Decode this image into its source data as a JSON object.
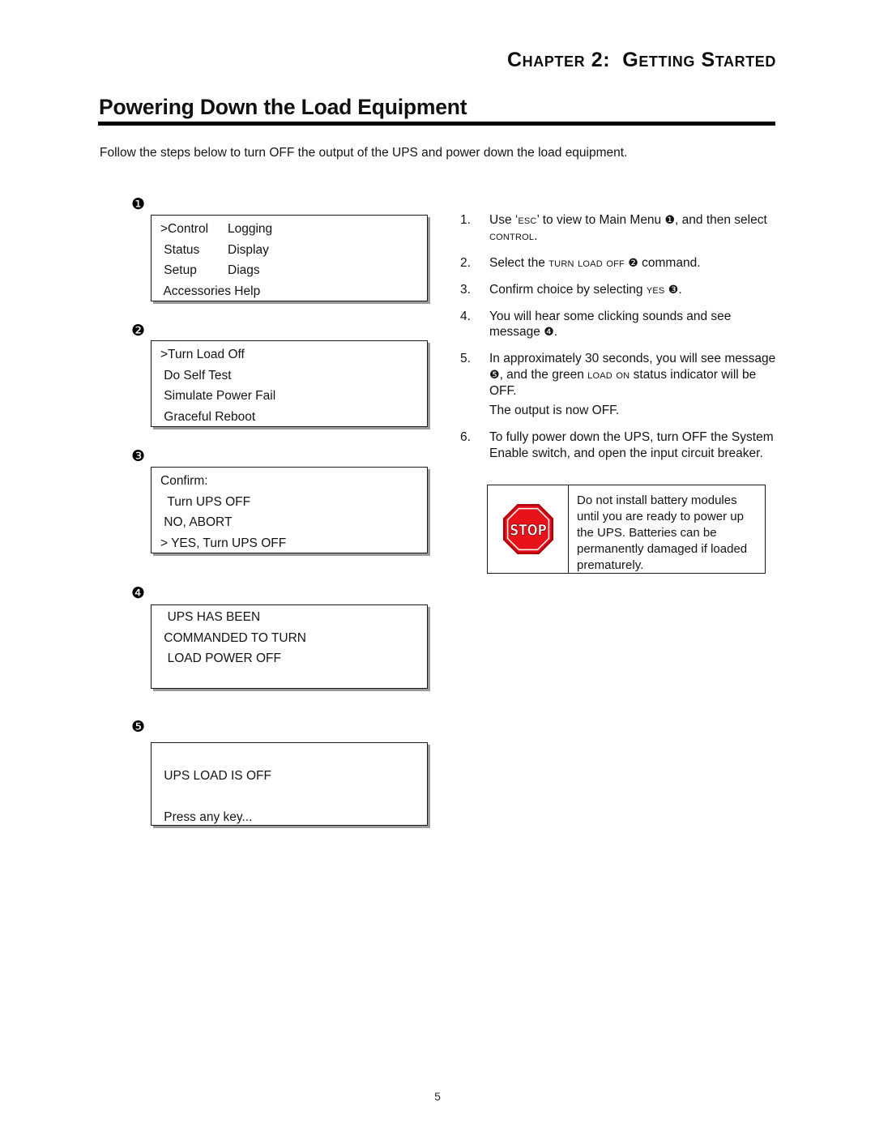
{
  "header": {
    "chapter": "Chapter 2:  Getting Started"
  },
  "title": "Powering Down the Load Equipment",
  "intro": "Follow the steps below to turn OFF the output of the UPS and power down the load equipment.",
  "panels": [
    {
      "marker": "❶",
      "marker_number": "1",
      "lines_col1": [
        ">Control",
        " Status",
        " Setup",
        " Accessories Help"
      ],
      "lines_col2": [
        "Logging",
        "Display",
        "Diags",
        ""
      ]
    },
    {
      "marker": "❷",
      "marker_number": "2",
      "lines_col1": [
        ">Turn Load Off",
        " Do Self Test",
        " Simulate Power Fail",
        " Graceful Reboot"
      ],
      "lines_col2": [
        "",
        "",
        "",
        ""
      ]
    },
    {
      "marker": "❸",
      "marker_number": "3",
      "lines_col1": [
        "Confirm:",
        "  Turn UPS OFF",
        " NO, ABORT",
        "> YES, Turn UPS OFF"
      ],
      "lines_col2": [
        "",
        "",
        "",
        ""
      ]
    },
    {
      "marker": "❹",
      "marker_number": "4",
      "lines_col1": [
        "  UPS HAS BEEN",
        " COMMANDED TO TURN",
        "  LOAD POWER OFF",
        ""
      ],
      "lines_col2": [
        "",
        "",
        "",
        ""
      ]
    },
    {
      "marker": "❺",
      "marker_number": "5",
      "lines_col1": [
        "",
        " UPS LOAD IS OFF",
        "",
        " Press any key..."
      ],
      "lines_col2": [
        "",
        "",
        "",
        ""
      ]
    }
  ],
  "steps": [
    {
      "number": "1.",
      "parts": [
        {
          "t": "Use ‘",
          "s": "n"
        },
        {
          "t": "esc",
          "s": "sc"
        },
        {
          "t": "’ to view to Main Menu ",
          "s": "n"
        },
        {
          "t": "❶",
          "s": "b"
        },
        {
          "t": ", and then select ",
          "s": "n"
        },
        {
          "t": "control",
          "s": "sc"
        },
        {
          "t": ".",
          "s": "n"
        }
      ]
    },
    {
      "number": "2.",
      "parts": [
        {
          "t": "Select the ",
          "s": "n"
        },
        {
          "t": "turn load off",
          "s": "sc"
        },
        {
          "t": " ",
          "s": "n"
        },
        {
          "t": "❷",
          "s": "b"
        },
        {
          "t": " command.",
          "s": "n"
        }
      ]
    },
    {
      "number": "3.",
      "parts": [
        {
          "t": "Confirm choice by selecting ",
          "s": "n"
        },
        {
          "t": "yes",
          "s": "sc"
        },
        {
          "t": " ",
          "s": "n"
        },
        {
          "t": "❸",
          "s": "b"
        },
        {
          "t": ".",
          "s": "n"
        }
      ]
    },
    {
      "number": "4.",
      "parts": [
        {
          "t": "You will hear some clicking sounds and see message ",
          "s": "n"
        },
        {
          "t": "❹",
          "s": "b"
        },
        {
          "t": ".",
          "s": "n"
        }
      ]
    },
    {
      "number": "5.",
      "parts": [
        {
          "t": "In approximately 30 seconds, you will see message ",
          "s": "n"
        },
        {
          "t": "❺",
          "s": "b"
        },
        {
          "t": ", and the green ",
          "s": "n"
        },
        {
          "t": "load on",
          "s": "sc"
        },
        {
          "t": " status indicator will be OFF.",
          "s": "n"
        }
      ],
      "extra_line": "The output is now OFF."
    },
    {
      "number": "6.",
      "parts": [
        {
          "t": "To fully power down the UPS, turn OFF the System Enable switch, and open the input circuit breaker.",
          "s": "n"
        }
      ]
    }
  ],
  "warning": {
    "icon_label": "STOP",
    "text": "Do not install battery modules until you are ready to power up the UPS. Batteries can be permanently damaged if loaded prematurely.",
    "icon_color": "#e8121a",
    "icon_border_color": "#b00008"
  },
  "footer": {
    "page_number": "5"
  }
}
